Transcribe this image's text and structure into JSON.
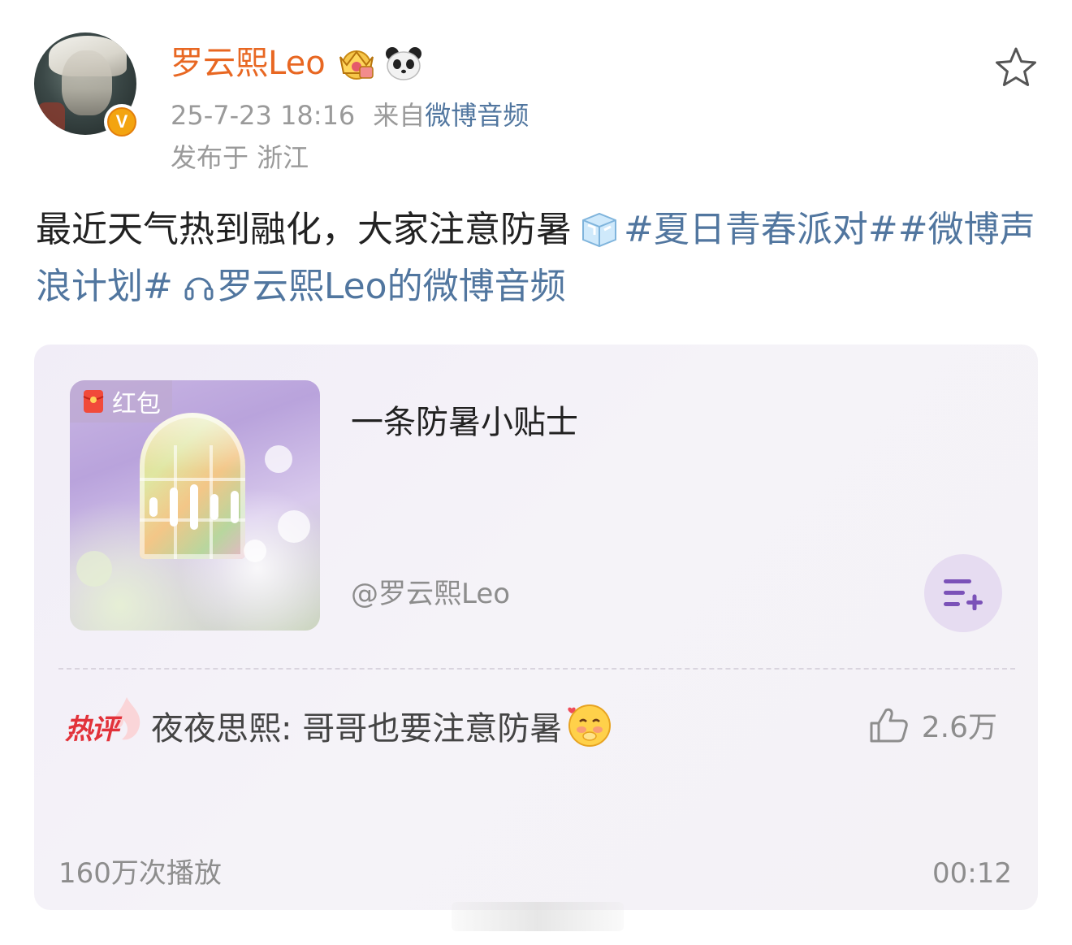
{
  "post": {
    "author": "罗云熙Leo",
    "verified_mark": "V",
    "time": "25-7-23 18:16",
    "source_prefix": "来自",
    "source_link": "微博音频",
    "location": "发布于 浙江",
    "text": {
      "body": "最近天气热到融化，大家注意防暑",
      "topic_1": "#夏日青春派对#",
      "topic_2": "#微博声浪计划#",
      "audio_link": "罗云熙Leo的微博音频"
    },
    "icons": {
      "crown": "crown-badge-icon",
      "panda": "panda-icon",
      "ice": "ice-cube-icon",
      "star": "star-outline-icon",
      "headphones": "headphones-icon"
    }
  },
  "audio_card": {
    "badge": "红包",
    "title": "一条防暑小贴士",
    "author": "@罗云熙Leo",
    "hot_comment": {
      "label": "热评",
      "text": "夜夜思熙: 哥哥也要注意防暑",
      "likes": "2.6万"
    },
    "play_count": "160万次播放",
    "duration": "00:12"
  },
  "colors": {
    "author_orange": "#e86722",
    "link_blue": "#51769f",
    "hot_red": "#e2323a",
    "card_bg": "#f3f0f7",
    "playlist_purple": "#7b52b8"
  }
}
